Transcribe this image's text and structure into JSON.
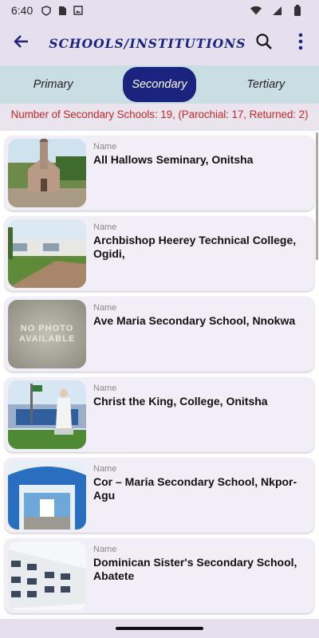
{
  "status_bar": {
    "time": "6:40"
  },
  "app_bar": {
    "title": "SCHOOLS/INSTITUTIONS"
  },
  "tabs": [
    {
      "label": "Primary"
    },
    {
      "label": "Secondary"
    },
    {
      "label": "Tertiary"
    }
  ],
  "summary": {
    "text": "Number of Secondary Schools: 19, (Parochial: 17, Returned: 2)"
  },
  "schools": [
    {
      "label": "Name",
      "name": "All Hallows Seminary, Onitsha"
    },
    {
      "label": "Name",
      "name": "Archbishop Heerey Technical College, Ogidi,"
    },
    {
      "label": "Name",
      "name": "Ave Maria Secondary School, Nnokwa",
      "photo_text": "NO PHOTO AVAILABLE"
    },
    {
      "label": "Name",
      "name": "Christ the King, College, Onitsha"
    },
    {
      "label": "Name",
      "name": "Cor – Maria Secondary School, Nkpor-Agu"
    },
    {
      "label": "Name",
      "name": "Dominican Sister's Secondary School, Abatete"
    }
  ],
  "colors": {
    "accent": "#1a237e",
    "alert": "#c62828",
    "tab_bar": "#c9dde3"
  },
  "icons": [
    "back-arrow-icon",
    "search-icon",
    "more-vert-icon",
    "wifi-icon",
    "signal-icon",
    "battery-icon"
  ]
}
